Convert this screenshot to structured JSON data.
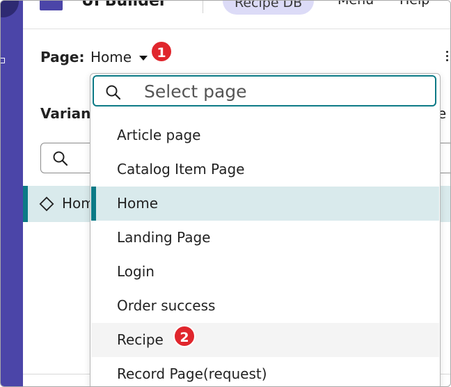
{
  "header": {
    "app_title": "UI Builder",
    "active_app": "Recipe DB",
    "nav": [
      "Menu",
      "Help"
    ]
  },
  "page_selector": {
    "label": "Page:",
    "value": "Home"
  },
  "background": {
    "section_label": "Variants",
    "right_text": "te",
    "row_label": "Home"
  },
  "dropdown": {
    "search_placeholder": "Select page",
    "items": [
      {
        "label": "Article page"
      },
      {
        "label": "Catalog Item Page"
      },
      {
        "label": "Home",
        "selected": true
      },
      {
        "label": "Landing Page"
      },
      {
        "label": "Login"
      },
      {
        "label": "Order success"
      },
      {
        "label": "Recipe",
        "hover": true
      },
      {
        "label": "Record Page(request)"
      }
    ]
  },
  "badges": [
    "1",
    "2"
  ],
  "colors": {
    "rail": "#4b45a8",
    "accent": "#0c7a86",
    "selected_bg": "#d9eaec",
    "badge": "#e0262d",
    "pill": "#dcdbf7"
  }
}
